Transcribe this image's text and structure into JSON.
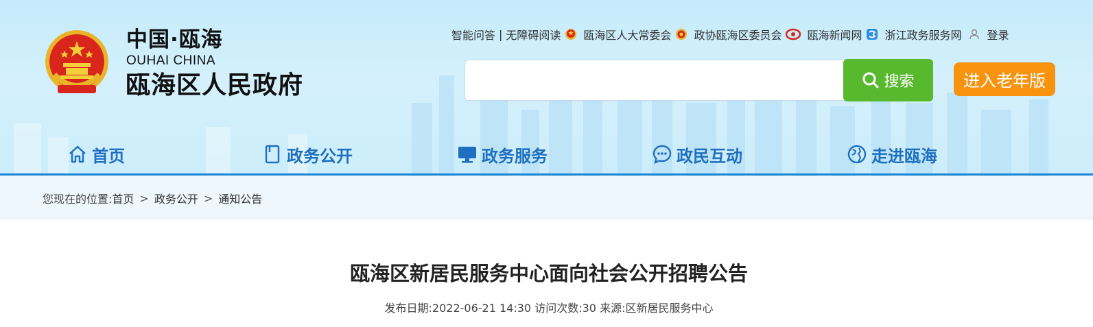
{
  "logo": {
    "cn": "中国·瓯海",
    "en": "OUHAI CHINA",
    "name": "瓯海区人民政府"
  },
  "toplinks": {
    "qa": "智能问答",
    "sep": "|",
    "accessibility": "无障碍阅读",
    "npc": "瓯海区人大常委会",
    "cppcc": "政协瓯海区委员会",
    "news": "瓯海新闻网",
    "zjservice": "浙江政务服务网",
    "login": "登录"
  },
  "search": {
    "placeholder": "",
    "button_label": "搜索"
  },
  "elder_mode_label": "进入老年版",
  "nav": [
    {
      "label": "首页",
      "icon": "home-icon"
    },
    {
      "label": "政务公开",
      "icon": "document-icon"
    },
    {
      "label": "政务服务",
      "icon": "monitor-icon"
    },
    {
      "label": "政民互动",
      "icon": "chat-icon"
    },
    {
      "label": "走进瓯海",
      "icon": "globe-icon"
    }
  ],
  "breadcrumb": {
    "prefix": "您现在的位置:",
    "items": [
      "首页",
      "政务公开",
      "通知公告"
    ],
    "separator": ">"
  },
  "article": {
    "title": "瓯海区新居民服务中心面向社会公开招聘公告",
    "date_label": "发布日期:",
    "date": "2022-06-21 14:30",
    "visits_label": "访问次数:",
    "visits": "30",
    "source_label": "来源:",
    "source": "区新居民服务中心"
  },
  "colors": {
    "nav_text": "#1e6fbf",
    "search_button": "#59b92e",
    "elder_button": "#f7930f",
    "header_line": "#1e86d4"
  }
}
